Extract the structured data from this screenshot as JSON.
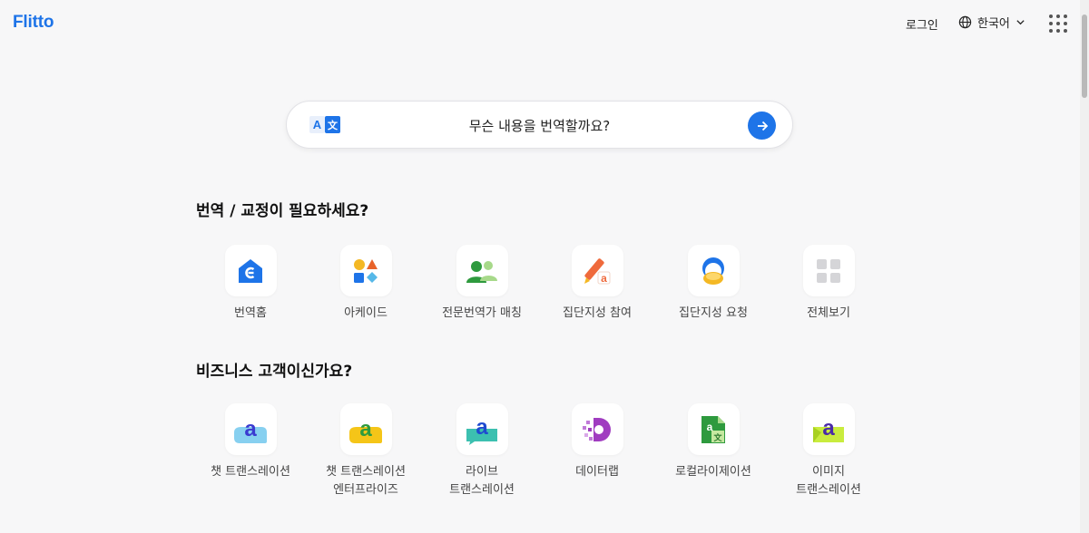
{
  "header": {
    "logo": "Flitto",
    "login": "로그인",
    "language": "한국어"
  },
  "search": {
    "placeholder": "무슨 내용을 번역할까요?"
  },
  "section1": {
    "title": "번역 / 교정이 필요하세요?",
    "items": [
      {
        "label": "번역홈",
        "icon": "translation-home-icon"
      },
      {
        "label": "아케이드",
        "icon": "arcade-icon"
      },
      {
        "label": "전문번역가 매칭",
        "icon": "pro-translator-icon"
      },
      {
        "label": "집단지성 참여",
        "icon": "crowd-participate-icon"
      },
      {
        "label": "집단지성 요청",
        "icon": "crowd-request-icon"
      },
      {
        "label": "전체보기",
        "icon": "view-all-icon"
      }
    ]
  },
  "section2": {
    "title": "비즈니스 고객이신가요?",
    "items": [
      {
        "label": "챗 트랜스레이션",
        "icon": "chat-translation-icon"
      },
      {
        "label": "챗 트랜스레이션\n엔터프라이즈",
        "icon": "chat-enterprise-icon"
      },
      {
        "label": "라이브\n트랜스레이션",
        "icon": "live-translation-icon"
      },
      {
        "label": "데이터랩",
        "icon": "datalab-icon"
      },
      {
        "label": "로컬라이제이션",
        "icon": "localization-icon"
      },
      {
        "label": "이미지\n트랜스레이션",
        "icon": "image-translation-icon"
      }
    ]
  },
  "colors": {
    "brand": "#1e74e8",
    "background": "#f7f7f8"
  }
}
